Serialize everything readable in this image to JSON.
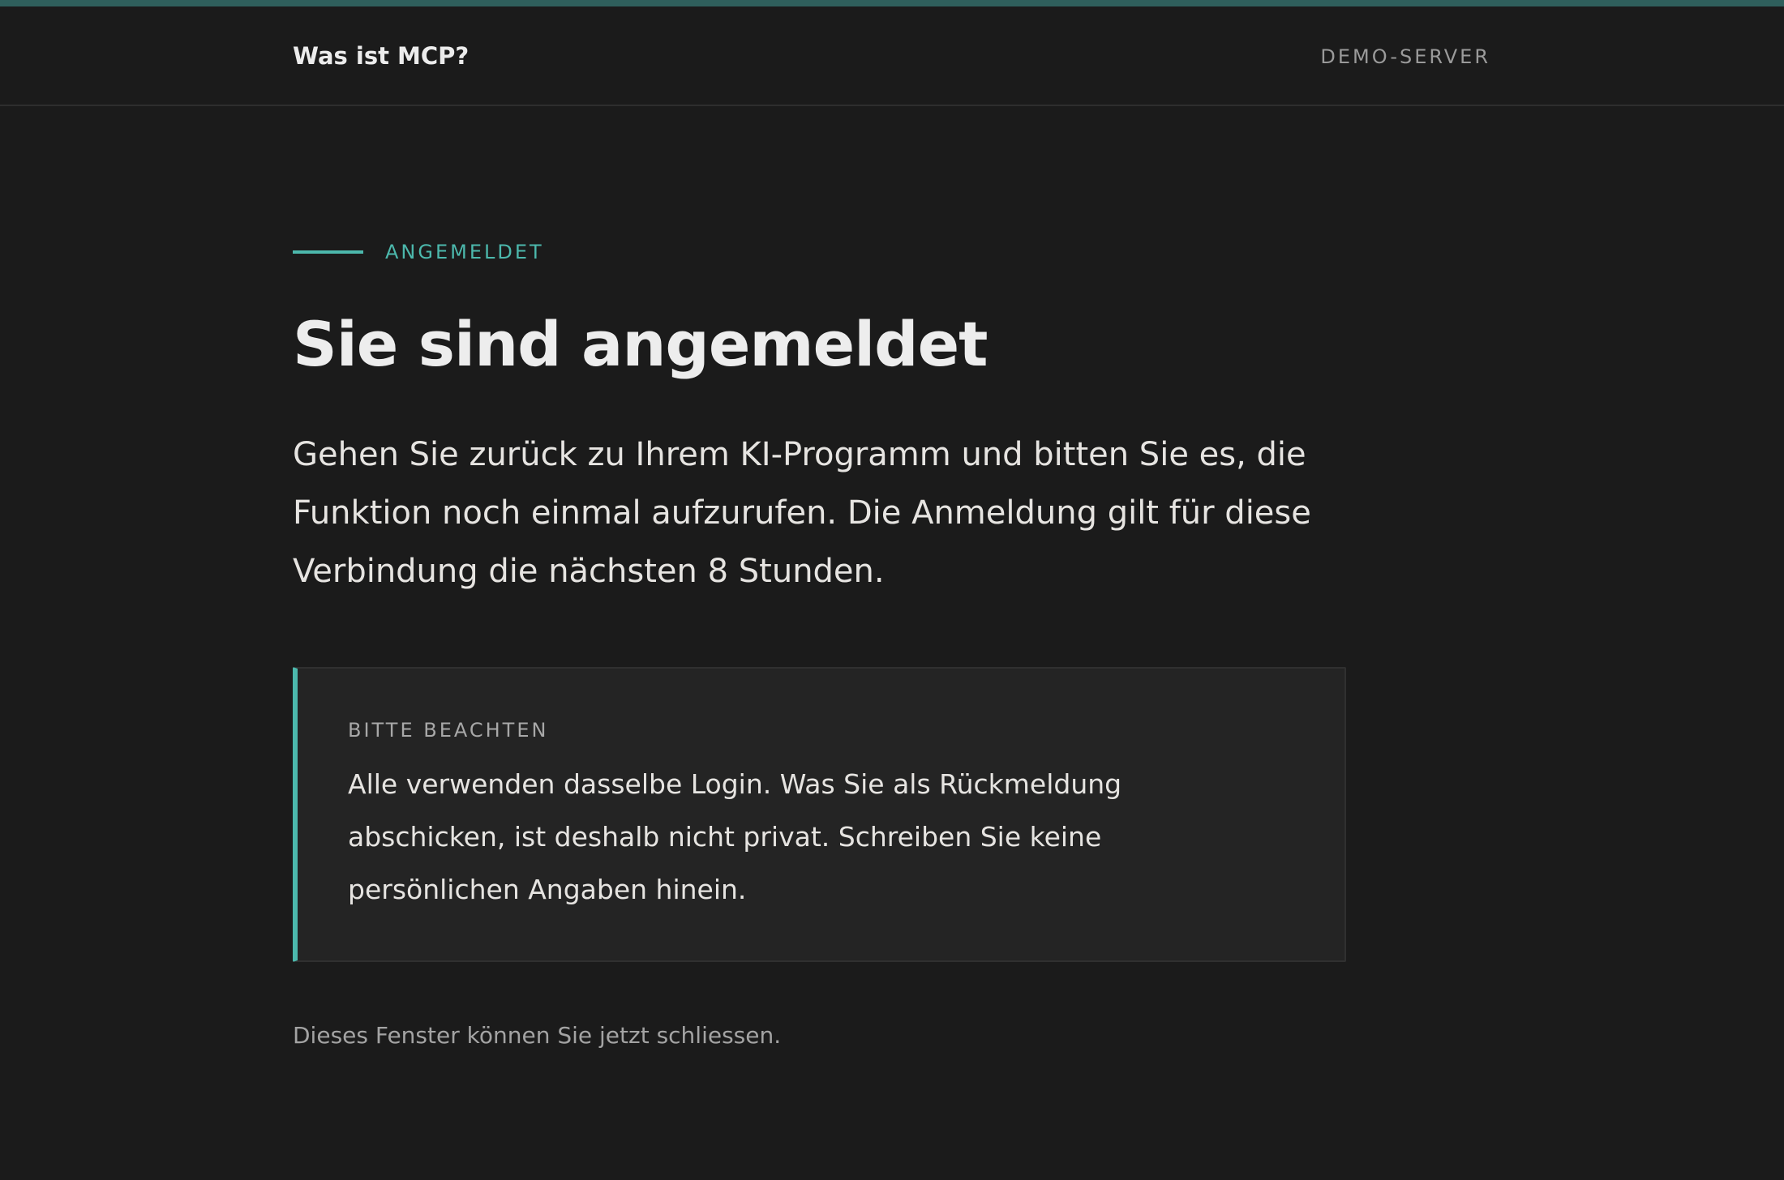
{
  "header": {
    "brand": "Was ist MCP?",
    "server_label": "DEMO-SERVER"
  },
  "main": {
    "eyebrow": "ANGEMELDET",
    "title": "Sie sind angemeldet",
    "lead": "Gehen Sie zurück zu Ihrem KI-Programm und bitten Sie es, die Funktion noch einmal aufzurufen. Die Anmeldung gilt für diese Verbindung die nächsten 8 Stunden.",
    "note": {
      "label": "BITTE BEACHTEN",
      "text": "Alle verwenden dasselbe Login. Was Sie als Rückmeldung abschicken, ist deshalb nicht privat. Schreiben Sie keine persönlichen Angaben hinein."
    },
    "footer": "Dieses Fenster können Sie jetzt schliessen."
  },
  "colors": {
    "background": "#1b1b1b",
    "accent": "#4cb8ac",
    "top_bar": "#2f5f5c",
    "note_background": "#242424"
  }
}
